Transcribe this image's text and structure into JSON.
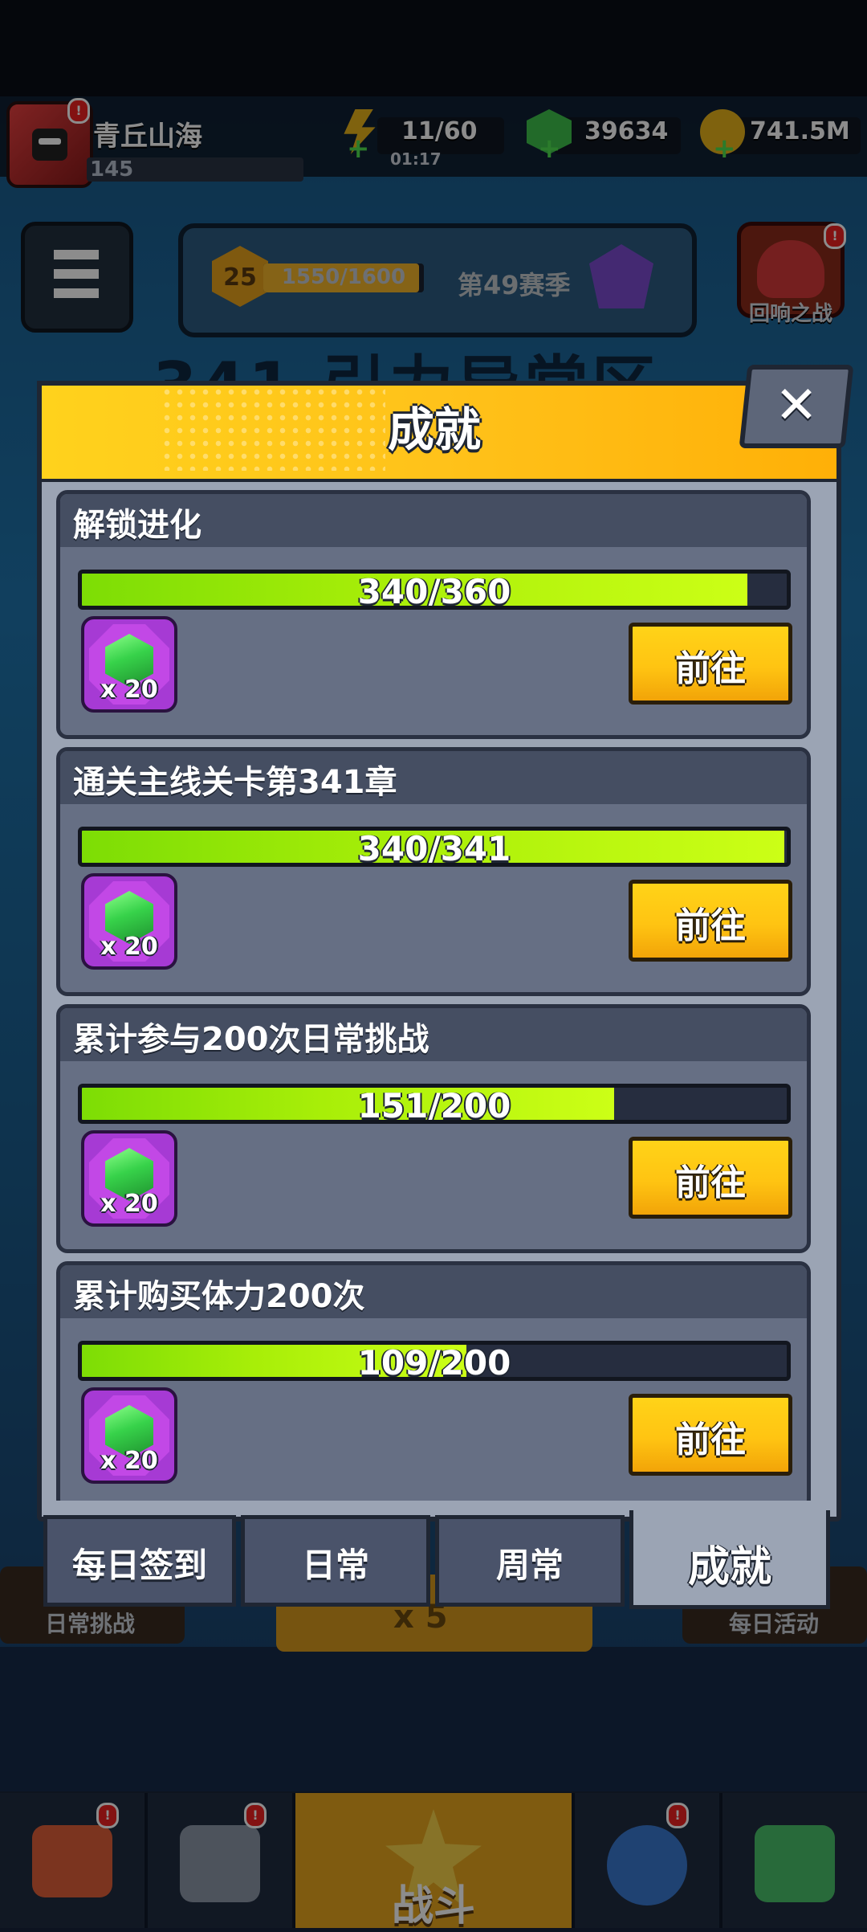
{
  "player": {
    "name": "青丘山海",
    "level": "145"
  },
  "resources": {
    "stamina": {
      "value": "11/60",
      "timer": "01:17"
    },
    "gems": {
      "value": "39634"
    },
    "coins": {
      "value": "741.5M"
    }
  },
  "season": {
    "level": "25",
    "progress": "1550/1600",
    "progress_fraction": 0.969,
    "name": "第49赛季"
  },
  "side_buttons": {
    "echo_battle": "回响之战"
  },
  "background": {
    "chapter_title": "341 引力异常区",
    "daily_challenge": "日常挑战",
    "start_cost": "x 5",
    "daily_events": "每日活动",
    "battle": "战斗"
  },
  "modal": {
    "title": "成就",
    "close_symbol": "✕",
    "go_label": "前往",
    "achievements": [
      {
        "title": "解锁进化",
        "progress": "340/360",
        "fraction": 0.944,
        "reward_qty": "x 20",
        "reward_icon": "green-gem-icon"
      },
      {
        "title": "通关主线关卡第341章",
        "progress": "340/341",
        "fraction": 0.997,
        "reward_qty": "x 20",
        "reward_icon": "green-gem-icon"
      },
      {
        "title": "累计参与200次日常挑战",
        "progress": "151/200",
        "fraction": 0.755,
        "reward_qty": "x 20",
        "reward_icon": "green-gem-icon"
      },
      {
        "title": "累计购买体力200次",
        "progress": "109/200",
        "fraction": 0.545,
        "reward_qty": "x 20",
        "reward_icon": "green-gem-icon"
      }
    ],
    "tabs": [
      {
        "label": "每日签到",
        "active": false
      },
      {
        "label": "日常",
        "active": false
      },
      {
        "label": "周常",
        "active": false
      },
      {
        "label": "成就",
        "active": true
      }
    ]
  },
  "colors": {
    "header_yellow": "#ffc21a",
    "progress_green": "#a8ee08",
    "button_yellow": "#ffc412",
    "reward_purple": "#a63ad4",
    "card_bg": "#666f84",
    "panel_bg": "#9ba4b4"
  }
}
